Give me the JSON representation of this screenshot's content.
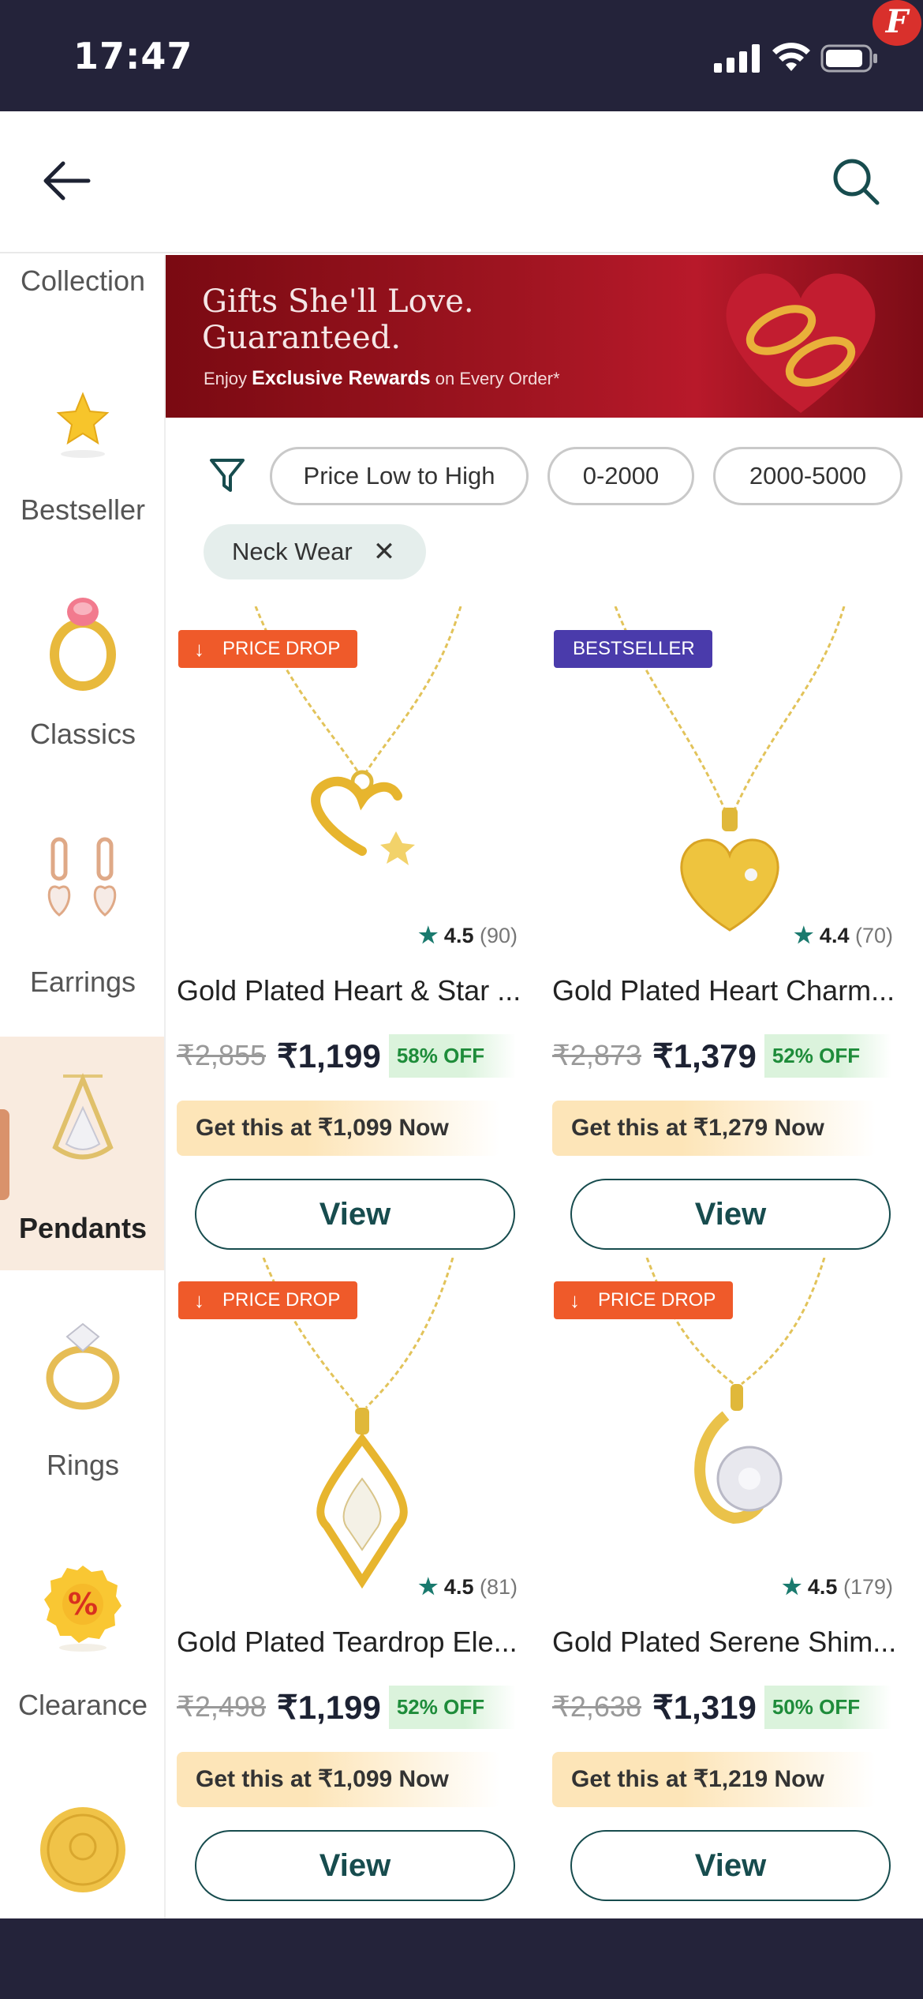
{
  "status_bar": {
    "time": "17:47",
    "avatar_letter": "F"
  },
  "sidebar": {
    "items": [
      {
        "label": "Collection"
      },
      {
        "label": "Bestseller"
      },
      {
        "label": "Classics"
      },
      {
        "label": "Earrings"
      },
      {
        "label": "Pendants",
        "active": true
      },
      {
        "label": "Rings"
      },
      {
        "label": "Clearance"
      },
      {
        "label": ""
      }
    ]
  },
  "banner": {
    "title": "Gifts She'll Love. Guaranteed.",
    "sub_prefix": "Enjoy ",
    "sub_bold": "Exclusive Rewards",
    "sub_suffix": " on Every Order*"
  },
  "filters": {
    "chips": [
      "Price Low to High",
      "0-2000",
      "2000-5000"
    ],
    "active_chip": "Neck Wear",
    "active_chip_remove": "✕"
  },
  "products": [
    {
      "badge": "PRICE DROP",
      "badge_type": "drop",
      "rating": "4.5",
      "reviews": "(90)",
      "name": "Gold Plated Heart & Star ...",
      "mrp": "₹2,855",
      "price": "₹1,199",
      "off": "58% OFF",
      "offer": "Get this at ₹1,099 Now",
      "cta": "View"
    },
    {
      "badge": "BESTSELLER",
      "badge_type": "best",
      "rating": "4.4",
      "reviews": "(70)",
      "name": "Gold Plated Heart Charm...",
      "mrp": "₹2,873",
      "price": "₹1,379",
      "off": "52% OFF",
      "offer": "Get this at ₹1,279 Now",
      "cta": "View"
    },
    {
      "badge": "PRICE DROP",
      "badge_type": "drop",
      "rating": "4.5",
      "reviews": "(81)",
      "name": "Gold Plated Teardrop Ele...",
      "mrp": "₹2,498",
      "price": "₹1,199",
      "off": "52% OFF",
      "offer": "Get this at ₹1,099 Now",
      "cta": "View"
    },
    {
      "badge": "PRICE DROP",
      "badge_type": "drop",
      "rating": "4.5",
      "reviews": "(179)",
      "name": "Gold Plated Serene Shim...",
      "mrp": "₹2,638",
      "price": "₹1,319",
      "off": "50% OFF",
      "offer": "Get this at ₹1,219 Now",
      "cta": "View"
    }
  ],
  "colors": {
    "accent": "#174c4e",
    "price_drop": "#ef5a2a",
    "bestseller": "#4a3bab",
    "status_bar": "#24233a"
  }
}
